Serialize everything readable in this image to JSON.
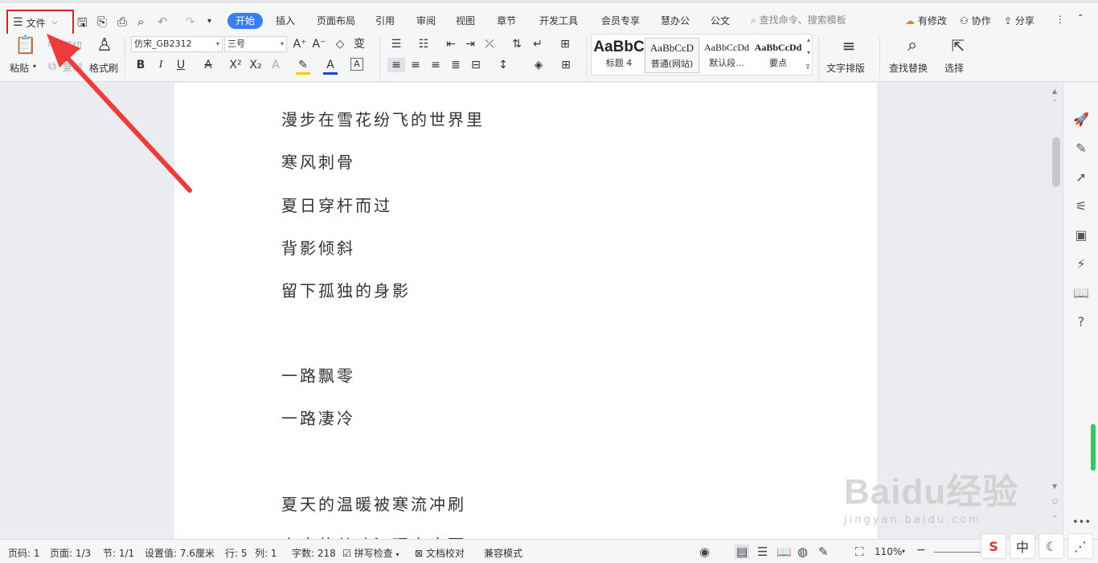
{
  "menubar": {
    "file_label": "文件",
    "tabs": [
      "开始",
      "插入",
      "页面布局",
      "引用",
      "审阅",
      "视图",
      "章节",
      "开发工具",
      "会员专享",
      "慧办公",
      "公文"
    ],
    "search_placeholder": "查找命令、搜索模板",
    "right": {
      "revise": "有修改",
      "collab": "协作",
      "share": "分享"
    }
  },
  "ribbon": {
    "paste": "粘贴",
    "cut": "剪切",
    "copy": "复制",
    "format_painter": "格式刷",
    "font_name": "仿宋_GB2312",
    "font_size": "三号",
    "styles": [
      {
        "preview": "AaBbC",
        "name": "标题 4"
      },
      {
        "preview": "AaBbCcD",
        "name": "普通(网站)"
      },
      {
        "preview": "AaBbCcDd",
        "name": "默认段..."
      },
      {
        "preview": "AaBbCcDd",
        "name": "要点"
      }
    ],
    "text_layout": "文字排版",
    "find_replace": "查找替换",
    "select": "选择"
  },
  "document": {
    "lines": [
      "漫步在雪花纷飞的世界里",
      "寒风刺骨",
      "夏日穿杆而过",
      "背影倾斜",
      "留下孤独的身影",
      "",
      "一路飘零",
      "一路凄冷",
      "",
      "夏天的温暖被寒流冲刷",
      "六古的从叶江理安府而"
    ]
  },
  "status": {
    "page_code": "页码: 1",
    "page": "页面: 1/3",
    "section": "节: 1/1",
    "setting": "设置值: 7.6厘米",
    "row": "行: 5",
    "col": "列: 1",
    "words": "字数: 218",
    "spell": "拼写检查",
    "proof": "文档校对",
    "compat": "兼容模式",
    "zoom": "110%"
  },
  "watermark": {
    "brand": "Baidu经验",
    "url": "jingyan.baidu.com"
  },
  "ime": {
    "mode": "中"
  },
  "colors": {
    "accent": "#3a7ef7",
    "highlight_box": "#e02020",
    "arrow": "#ee3b3b"
  }
}
